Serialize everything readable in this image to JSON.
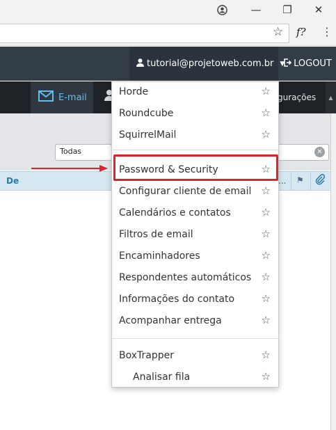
{
  "browser": {
    "minimize_glyph": "—",
    "restore_glyph": "❐",
    "close_glyph": "✕",
    "star_glyph": "☆",
    "ext_glyph": "f?",
    "menu_glyph": "⋮",
    "icons": [
      "account-circle-icon",
      "bookmark-star-icon",
      "extension-icon",
      "kebab-menu-icon"
    ]
  },
  "topbar": {
    "user_email": "tutorial@projetoweb.com.br",
    "caret": "▼",
    "logout_label": "LOGOUT",
    "colors": {
      "background": "#333d47",
      "text": "#ffffff"
    }
  },
  "appnav": {
    "email_label": "E-mail",
    "config_label": "gurações",
    "scroll_glyph": "▲",
    "colors": {
      "active_text": "#5cc0ee",
      "background": "#1f2226"
    }
  },
  "mail": {
    "folder_select_value": "Todas",
    "clear_glyph": "✕",
    "column_from": "De",
    "column_dots": "...",
    "flag_glyph": "⚑"
  },
  "dropdown": {
    "items_top": [
      {
        "label": "Horde"
      },
      {
        "label": "Roundcube"
      },
      {
        "label": "SquirrelMail"
      }
    ],
    "items_middle": [
      {
        "label": "Password & Security"
      },
      {
        "label": "Configurar cliente de email"
      },
      {
        "label": "Calendários e contatos"
      },
      {
        "label": "Filtros de email"
      },
      {
        "label": "Encaminhadores"
      },
      {
        "label": "Respondentes automáticos"
      },
      {
        "label": "Informações do contato"
      },
      {
        "label": "Acompanhar entrega"
      }
    ],
    "items_bottom": [
      {
        "label": "BoxTrapper"
      },
      {
        "label": "Analisar fila"
      }
    ],
    "star_glyph": "☆",
    "highlight_color": "#d9242b"
  }
}
